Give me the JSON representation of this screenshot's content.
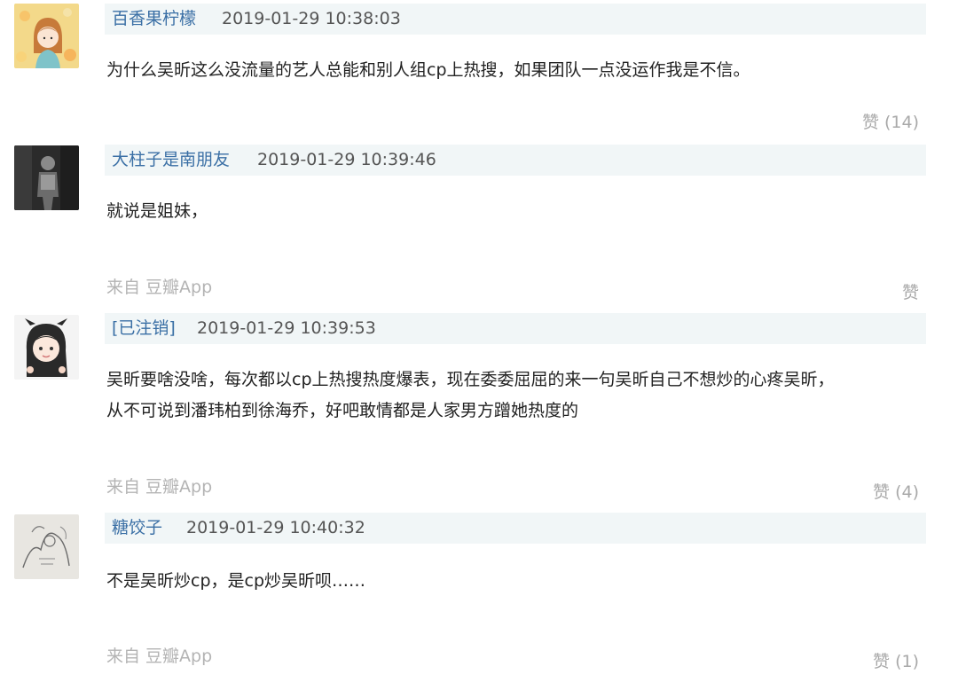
{
  "comments": [
    {
      "author": "百香果柠檬",
      "time": "2019-01-29 10:38:03",
      "text": "为什么吴昕这么没流量的艺人总能和别人组cp上热搜，如果团队一点没运作我是不信。",
      "source": "",
      "like": "赞 (14)",
      "avatar_icon": "avatar-girl-illustration-icon"
    },
    {
      "author": "大柱子是南朋友",
      "time": "2019-01-29 10:39:46",
      "text": "就说是姐妹，",
      "source": "来自 豆瓣App",
      "like": "赞",
      "avatar_icon": "avatar-dark-photo-icon"
    },
    {
      "author": "[已注销]",
      "time": "2019-01-29 10:39:53",
      "text": "吴昕要啥没啥，每次都以cp上热搜热度爆表，现在委委屈屈的来一句吴昕自己不想炒的心疼吴昕，",
      "text2": "从不可说到潘玮柏到徐海乔，好吧敢情都是人家男方蹭她热度的",
      "source": "来自 豆瓣App",
      "like": "赞 (4)",
      "avatar_icon": "avatar-cartoon-girl-icon"
    },
    {
      "author": "糖饺子",
      "time": "2019-01-29 10:40:32",
      "text": "不是吴昕炒cp，是cp炒吴昕呗……",
      "source": "来自 豆瓣App",
      "like": "赞 (1)",
      "avatar_icon": "avatar-sketch-icon"
    }
  ],
  "colors": {
    "author": "#3a6fa5",
    "meta_bar": "#f1f6f7",
    "muted": "#b4b4b4"
  }
}
